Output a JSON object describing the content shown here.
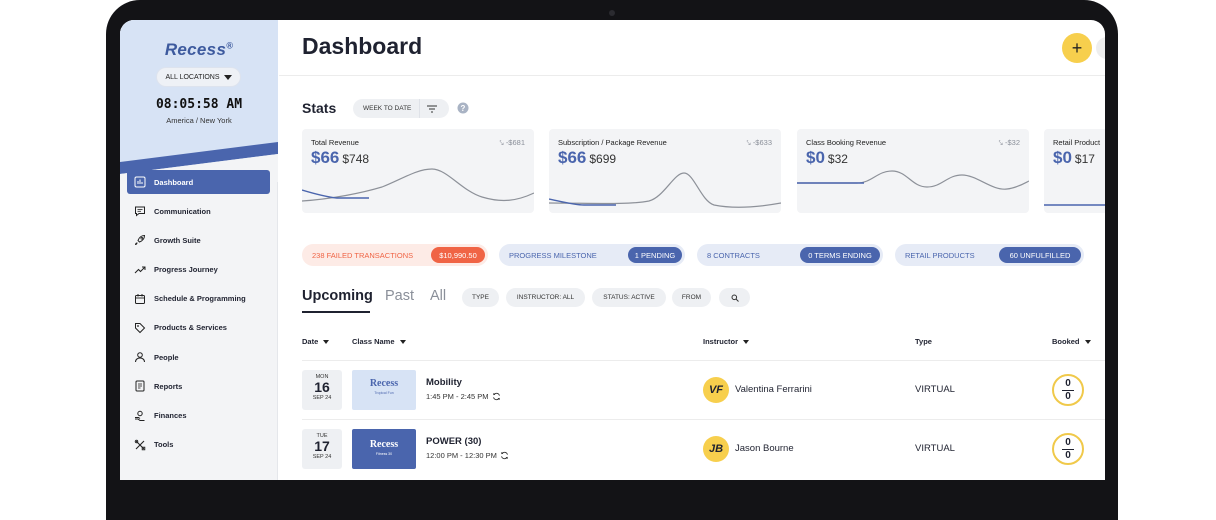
{
  "sidebar": {
    "logo": "Recess",
    "logo_mark": "®",
    "location": "ALL LOCATIONS",
    "clock": "08:05:58 AM",
    "timezone": "America / New York",
    "items": [
      {
        "label": "Dashboard",
        "icon": "chart-icon",
        "active": true
      },
      {
        "label": "Communication",
        "icon": "chat-icon"
      },
      {
        "label": "Growth Suite",
        "icon": "rocket-icon"
      },
      {
        "label": "Progress Journey",
        "icon": "trend-icon"
      },
      {
        "label": "Schedule & Programming",
        "icon": "calendar-icon"
      },
      {
        "label": "Products & Services",
        "icon": "tag-icon"
      },
      {
        "label": "People",
        "icon": "people-icon"
      },
      {
        "label": "Reports",
        "icon": "report-icon"
      },
      {
        "label": "Finances",
        "icon": "finance-icon"
      },
      {
        "label": "Tools",
        "icon": "tools-icon"
      }
    ]
  },
  "header": {
    "title": "Dashboard",
    "add_label": "+"
  },
  "stats": {
    "label": "Stats",
    "range": "WEEK TO DATE",
    "cards": [
      {
        "title": "Total Revenue",
        "value": "$66",
        "previous": "$748",
        "delta": "-$681"
      },
      {
        "title": "Subscription / Package Revenue",
        "value": "$66",
        "previous": "$699",
        "delta": "-$633"
      },
      {
        "title": "Class Booking Revenue",
        "value": "$0",
        "previous": "$32",
        "delta": "-$32"
      },
      {
        "title": "Retail Product",
        "value": "$0",
        "previous": "$17",
        "delta": ""
      }
    ]
  },
  "alerts": [
    {
      "label": "238 FAILED TRANSACTIONS",
      "badge": "$10,990.50"
    },
    {
      "label": "PROGRESS MILESTONE",
      "badge": "1 PENDING"
    },
    {
      "label": "8 CONTRACTS",
      "badge": "0 TERMS ENDING"
    },
    {
      "label": "RETAIL PRODUCTS",
      "badge": "60 UNFULFILLED"
    }
  ],
  "tabs": {
    "upcoming": "Upcoming",
    "past": "Past",
    "all": "All"
  },
  "filters": {
    "type": "TYPE",
    "instructor": "INSTRUCTOR: ALL",
    "status": "STATUS: ACTIVE",
    "from": "FROM"
  },
  "table": {
    "columns": {
      "date": "Date",
      "class_name": "Class Name",
      "instructor": "Instructor",
      "type": "Type",
      "booked": "Booked"
    },
    "rows": [
      {
        "dow": "MON",
        "day": "16",
        "month": "SEP 24",
        "thumb_title": "Recess",
        "thumb_sub": "Tropical Fun",
        "name": "Mobility",
        "time": "1:45 PM - 2:45 PM",
        "initials": "VF",
        "instructor": "Valentina Ferrarini",
        "type": "VIRTUAL",
        "booked": "0",
        "capacity": "0"
      },
      {
        "dow": "TUE",
        "day": "17",
        "month": "SEP 24",
        "thumb_title": "Recess",
        "thumb_sub": "Fitness 30",
        "name": "POWER (30)",
        "time": "12:00 PM - 12:30 PM",
        "initials": "JB",
        "instructor": "Jason Bourne",
        "type": "VIRTUAL",
        "booked": "0",
        "capacity": "0"
      }
    ]
  },
  "colors": {
    "accent": "#4a65ad",
    "accent_light": "#d7e3f5",
    "yellow": "#f7cf4d",
    "alert_red": "#f06445",
    "alert_red_bg": "#fdebe6"
  }
}
